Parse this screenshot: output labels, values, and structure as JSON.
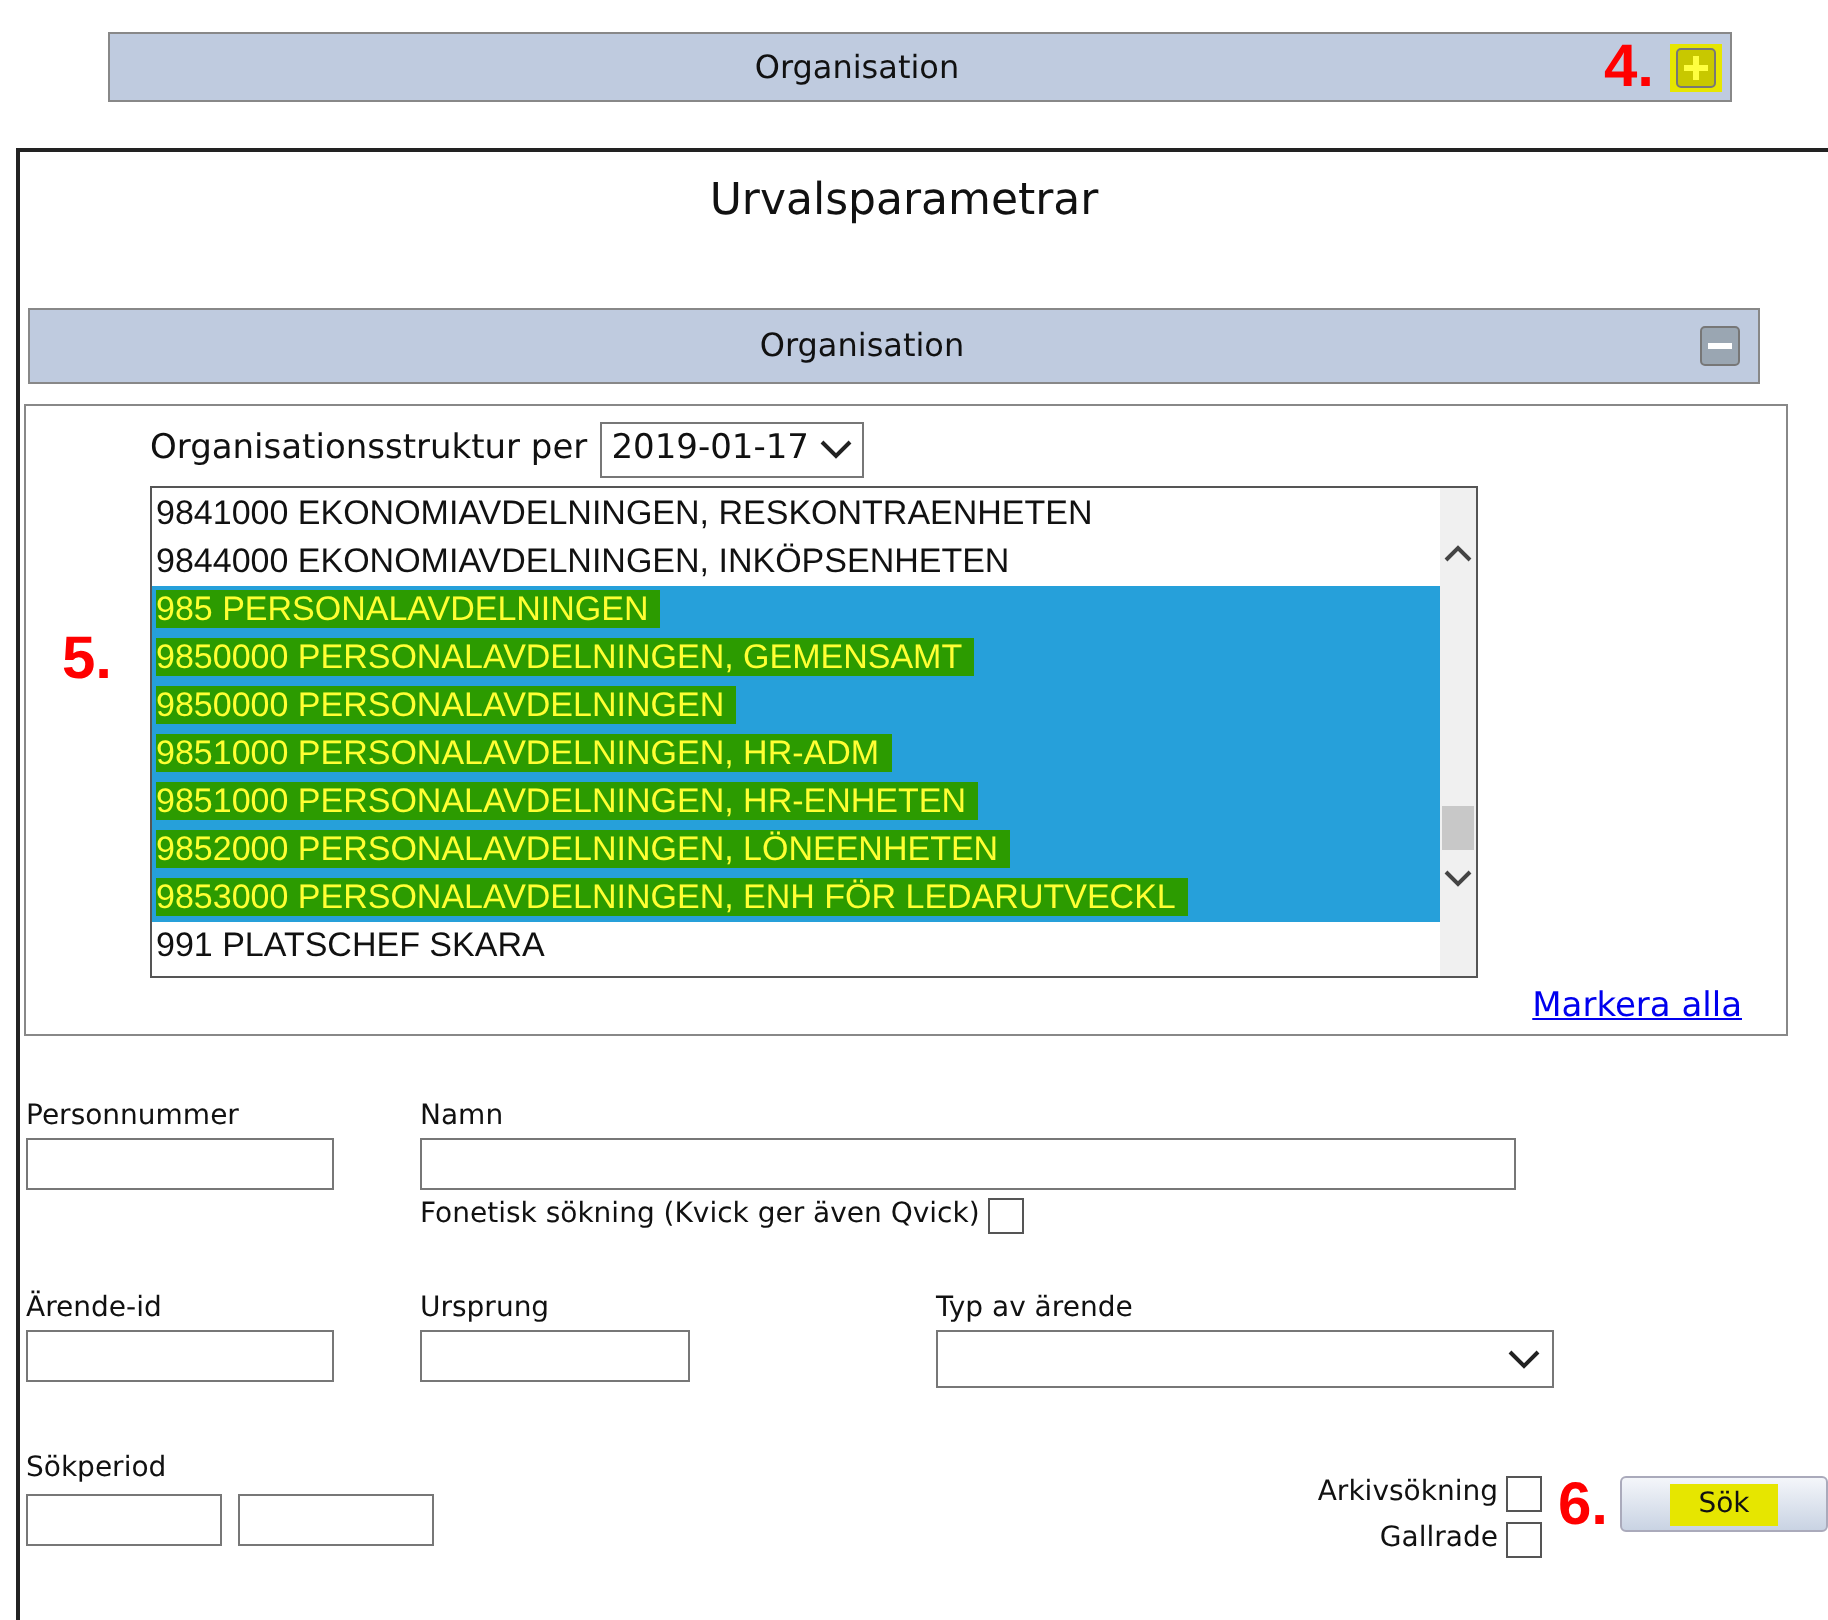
{
  "top_panel": {
    "title": "Organisation",
    "annotation": "4.",
    "expanded": false,
    "highlighted": true
  },
  "main": {
    "title": "Urvalsparametrar",
    "section": {
      "title": "Organisation",
      "expanded": true,
      "highlighted": false,
      "structure_label": "Organisationsstruktur per",
      "date": "2019-01-17",
      "annotation": "5.",
      "units": [
        {
          "label": "9841000 EKONOMIAVDELNINGEN, RESKONTRAENHETEN",
          "selected": false,
          "highlighted": false
        },
        {
          "label": "9844000 EKONOMIAVDELNINGEN, INKÖPSENHETEN",
          "selected": false,
          "highlighted": false
        },
        {
          "label": "985 PERSONALAVDELNINGEN",
          "selected": true,
          "highlighted": true
        },
        {
          "label": "9850000 PERSONALAVDELNINGEN, GEMENSAMT",
          "selected": true,
          "highlighted": true
        },
        {
          "label": "9850000 PERSONALAVDELNINGEN",
          "selected": true,
          "highlighted": true
        },
        {
          "label": "9851000 PERSONALAVDELNINGEN, HR-ADM",
          "selected": true,
          "highlighted": true
        },
        {
          "label": "9851000 PERSONALAVDELNINGEN, HR-ENHETEN",
          "selected": true,
          "highlighted": true
        },
        {
          "label": "9852000 PERSONALAVDELNINGEN, LÖNEENHETEN",
          "selected": true,
          "highlighted": true
        },
        {
          "label": "9853000 PERSONALAVDELNINGEN, ENH FÖR LEDARUTVECKL",
          "selected": true,
          "highlighted": true
        },
        {
          "label": "991 PLATSCHEF SKARA",
          "selected": false,
          "highlighted": false
        }
      ],
      "select_all": "Markera alla"
    }
  },
  "form": {
    "personnummer": {
      "label": "Personnummer"
    },
    "namn": {
      "label": "Namn"
    },
    "phonetic": {
      "label": "Fonetisk sökning (Kvick ger även Qvick)",
      "checked": false
    },
    "arende_id": {
      "label": "Ärende-id"
    },
    "ursprung": {
      "label": "Ursprung"
    },
    "typ": {
      "label": "Typ av ärende"
    },
    "sokperiod": {
      "label": "Sökperiod"
    },
    "archive": {
      "label": "Arkivsökning",
      "checked": false
    },
    "culled": {
      "label": "Gallrade",
      "checked": false
    },
    "search_button": {
      "label": "Sök",
      "annotation": "6.",
      "highlighted": true
    }
  }
}
